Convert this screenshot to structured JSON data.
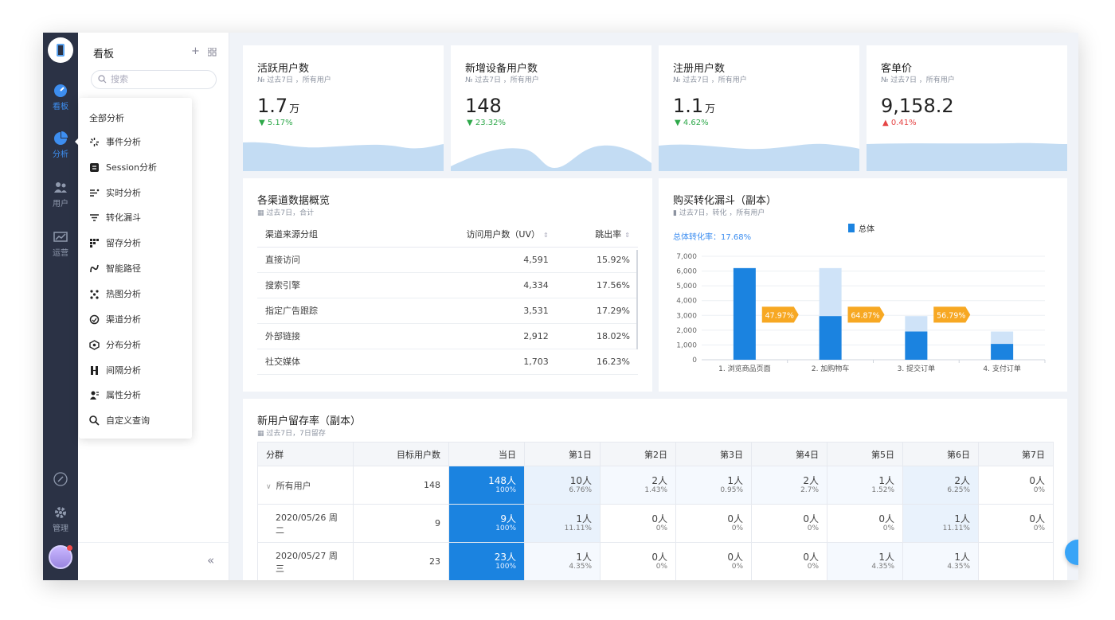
{
  "rail": {
    "items": [
      {
        "label": "看板",
        "icon": "dashboard-icon"
      },
      {
        "label": "分析",
        "icon": "pie-chart-icon"
      },
      {
        "label": "用户",
        "icon": "users-icon"
      },
      {
        "label": "运营",
        "icon": "operation-icon"
      },
      {
        "label": "管理",
        "icon": "gear-icon"
      }
    ]
  },
  "panel": {
    "title": "看板",
    "add_label": "+",
    "search_placeholder": "搜索",
    "collapse_label": "«"
  },
  "menu": {
    "head": "全部分析",
    "items": [
      "事件分析",
      "Session分析",
      "实时分析",
      "转化漏斗",
      "留存分析",
      "智能路径",
      "热图分析",
      "渠道分析",
      "分布分析",
      "间隔分析",
      "属性分析",
      "自定义查询"
    ]
  },
  "kpis": [
    {
      "name": "活跃用户数",
      "sub": "№ 过去7日 ，所有用户",
      "value": "1.7",
      "unit": "万",
      "change": "5.17%",
      "dir": "up"
    },
    {
      "name": "新增设备用户数",
      "sub": "№ 过去7日 ，所有用户",
      "value": "148",
      "unit": "",
      "change": "23.32%",
      "dir": "up"
    },
    {
      "name": "注册用户数",
      "sub": "№ 过去7日 ，所有用户",
      "value": "1.1",
      "unit": "万",
      "change": "4.62%",
      "dir": "up"
    },
    {
      "name": "客单价",
      "sub": "№ 过去7日 ，所有用户",
      "value": "9,158.2",
      "unit": "",
      "change": "0.41%",
      "dir": "down"
    }
  ],
  "channels": {
    "title": "各渠道数据概览",
    "sub": "过去7日，合计",
    "headers": [
      "渠道来源分组",
      "访问用户数（UV）",
      "跳出率"
    ],
    "rows": [
      [
        "直接访问",
        "4,591",
        "15.92%"
      ],
      [
        "搜索引擎",
        "4,334",
        "17.56%"
      ],
      [
        "指定广告跟踪",
        "3,531",
        "17.29%"
      ],
      [
        "外部链接",
        "2,912",
        "18.02%"
      ],
      [
        "社交媒体",
        "1,703",
        "16.23%"
      ]
    ]
  },
  "funnel": {
    "title": "购买转化漏斗（副本）",
    "sub": "过去7日，转化 ，所有用户",
    "rate_text": "总体转化率：17.68%",
    "legend": "总体",
    "colors": {
      "bar": "#1b83e0",
      "ghost": "#cfe3f8",
      "badge": "#f7a823"
    }
  },
  "chart_data": {
    "type": "bar",
    "categories": [
      "1. 浏览商品页面",
      "2. 加购物车",
      "3. 提交订单",
      "4. 支付订单"
    ],
    "series": [
      {
        "name": "总体",
        "values": [
          6200,
          2950,
          1910,
          1070
        ]
      }
    ],
    "conversion_rates": [
      "47.97%",
      "64.87%",
      "56.79%"
    ],
    "yticks": [
      "0",
      "1,000",
      "2,000",
      "3,000",
      "4,000",
      "5,000",
      "6,000",
      "7,000"
    ],
    "ylim": [
      0,
      7000
    ],
    "legend_position": "top"
  },
  "retention": {
    "title": "新用户留存率（副本）",
    "sub": "过去7日，7日留存",
    "headers": [
      "分群",
      "目标用户数",
      "当日",
      "第1日",
      "第2日",
      "第3日",
      "第4日",
      "第5日",
      "第6日",
      "第7日"
    ],
    "rows": [
      {
        "group": "所有用户",
        "expand": "∨",
        "target": "148",
        "cells": [
          [
            "148人",
            "100%"
          ],
          [
            "10人",
            "6.76%"
          ],
          [
            "2人",
            "1.43%"
          ],
          [
            "1人",
            "0.95%"
          ],
          [
            "2人",
            "2.7%"
          ],
          [
            "1人",
            "1.52%"
          ],
          [
            "2人",
            "6.25%"
          ],
          [
            "0人",
            "0%"
          ]
        ]
      },
      {
        "group": "2020/05/26 周二",
        "expand": "",
        "target": "9",
        "cells": [
          [
            "9人",
            "100%"
          ],
          [
            "1人",
            "11.11%"
          ],
          [
            "0人",
            "0%"
          ],
          [
            "0人",
            "0%"
          ],
          [
            "0人",
            "0%"
          ],
          [
            "0人",
            "0%"
          ],
          [
            "1人",
            "11.11%"
          ],
          [
            "0人",
            "0%"
          ]
        ]
      },
      {
        "group": "2020/05/27 周三",
        "expand": "",
        "target": "23",
        "cells": [
          [
            "23人",
            "100%"
          ],
          [
            "1人",
            "4.35%"
          ],
          [
            "0人",
            "0%"
          ],
          [
            "0人",
            "0%"
          ],
          [
            "0人",
            "0%"
          ],
          [
            "1人",
            "4.35%"
          ],
          [
            "1人",
            "4.35%"
          ],
          [
            "",
            ""
          ]
        ]
      }
    ]
  }
}
